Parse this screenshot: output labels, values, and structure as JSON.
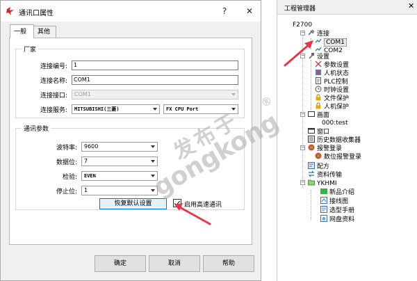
{
  "dialog": {
    "title": "通讯口属性",
    "help_label": "?",
    "close_label": "✕",
    "tabs": [
      {
        "label": "一般"
      },
      {
        "label": "其他"
      }
    ],
    "vendor_group": {
      "title": "厂家",
      "id_label": "连接编号:",
      "id_value": "1",
      "name_label": "连接名称:",
      "name_value": "COM1",
      "port_label": "连接接口:",
      "port_value": "COM1",
      "service_label": "连接服务:",
      "service_value": "MITSUBISHI(三菱)",
      "cpu_value": "FX CPU Port"
    },
    "comm_group": {
      "title": "通讯参数",
      "baud_label": "波特率:",
      "baud_value": "9600",
      "databits_label": "数据位:",
      "databits_value": "7",
      "parity_label": "检验:",
      "parity_value": "EVEN",
      "stopbits_label": "停止位:",
      "stopbits_value": "1",
      "restore_label": "恢复默认设置",
      "highspeed_label": "启用高速通讯",
      "highspeed_checked": true
    },
    "ok_label": "确定",
    "cancel_label": "取消",
    "help_btn_label": "帮助"
  },
  "project_manager": {
    "title": "工程管理器",
    "close_label": "✕",
    "tree": [
      {
        "label": "F2700"
      },
      {
        "label": "连接"
      },
      {
        "label": "COM1"
      },
      {
        "label": "COM2"
      },
      {
        "label": "设置"
      },
      {
        "label": "参数设置"
      },
      {
        "label": "人机状态"
      },
      {
        "label": "PLC控制"
      },
      {
        "label": "时钟设置"
      },
      {
        "label": "文件保护"
      },
      {
        "label": "人机保护"
      },
      {
        "label": "画面"
      },
      {
        "label": "000:test"
      },
      {
        "label": "窗口"
      },
      {
        "label": "历史数据收集器"
      },
      {
        "label": "报警登录"
      },
      {
        "label": "数位报警登录"
      },
      {
        "label": "配方"
      },
      {
        "label": "资料传输"
      },
      {
        "label": "YKHMI"
      },
      {
        "label": "新品介绍"
      },
      {
        "label": "接线图"
      },
      {
        "label": "选型手册"
      },
      {
        "label": "网盘资料"
      }
    ]
  },
  "watermark": {
    "cn": "发布于",
    "en": "gongkong",
    "reg": "®"
  },
  "colors": {
    "arrow": "#e8354a",
    "accent": "#0078d7"
  }
}
